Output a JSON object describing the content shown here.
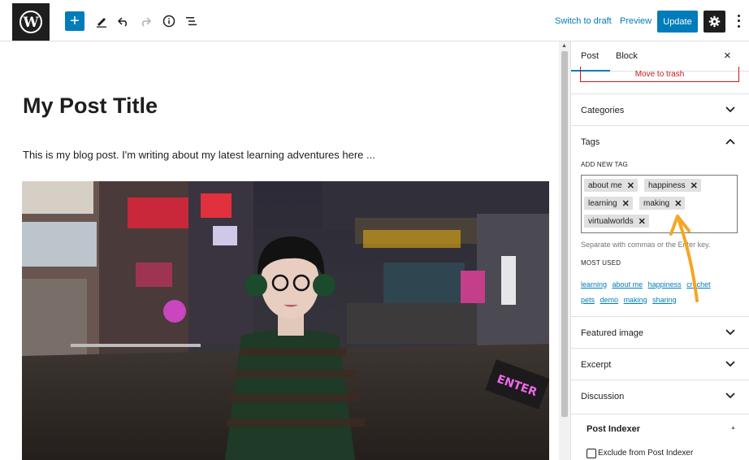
{
  "topbar": {
    "switch_to_draft": "Switch to draft",
    "preview": "Preview",
    "update": "Update",
    "icons": [
      "wordpress-logo-icon",
      "plus-icon",
      "pencil-icon",
      "undo-icon",
      "redo-icon",
      "info-icon",
      "list-view-icon",
      "gear-icon",
      "more-vertical-icon"
    ]
  },
  "editor": {
    "post_title": "My Post Title",
    "paragraph": "This is my blog post. I'm writing about my latest learning adventures here ...",
    "image_sign_text": "ENTER"
  },
  "sidebar": {
    "tabs": [
      "Post",
      "Block"
    ],
    "close": "×",
    "move_to_trash": "Move to trash",
    "categories": "Categories",
    "tags": {
      "title": "Tags",
      "add_new_label": "ADD NEW TAG",
      "items": [
        "about me",
        "happiness",
        "learning",
        "making",
        "virtualworlds"
      ],
      "help": "Separate with commas or the Enter key.",
      "most_used_label": "MOST USED",
      "most_used": [
        "learning",
        "about me",
        "happiness",
        "crochet",
        "pets",
        "demo",
        "making",
        "sharing"
      ]
    },
    "featured_image": "Featured image",
    "excerpt": "Excerpt",
    "discussion": "Discussion",
    "post_indexer": {
      "title": "Post Indexer",
      "exclude_label": "Exclude from Post Indexer"
    }
  },
  "colors": {
    "accent": "#007cba",
    "danger": "#cc1818",
    "annotation_arrow": "#f5a623"
  }
}
